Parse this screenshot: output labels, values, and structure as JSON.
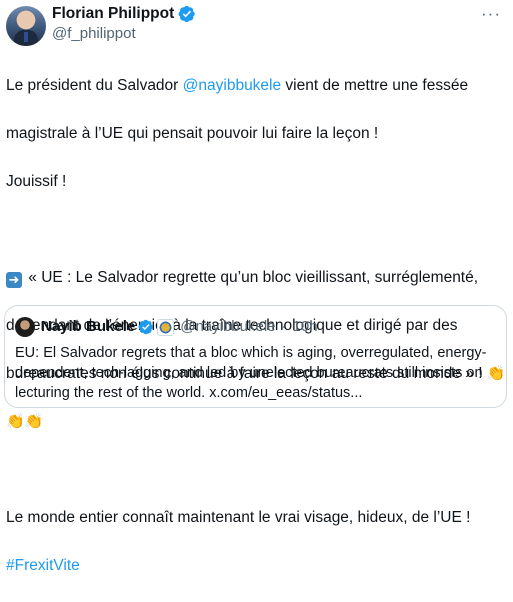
{
  "author": {
    "name": "Florian Philippot",
    "handle": "@f_philippot"
  },
  "more_label": "···",
  "tweet": {
    "p1_l1_before": "Le président du Salvador ",
    "p1_l1_mention": "@nayibbukele",
    "p1_l1_after": " vient de mettre une fessée",
    "p1_l2": "magistrale à l’UE qui pensait pouvoir lui faire la leçon !",
    "p1_l3": "Jouissif !",
    "p2_l1": " « UE : Le Salvador regrette qu’un bloc vieillissant, surréglementé,",
    "p2_l2": "dépendant de l’énergie, à la traîne technologique et dirigé par des",
    "p2_l3": "bureaucrates non élus continue à faire la leçon au reste du monde » !",
    "p3_l1": "Le monde entier connaît maintenant le vrai visage, hideux, de l’UE !",
    "hashtag": "#FrexitVite"
  },
  "quote": {
    "name": "Nayib Bukele",
    "handle": "@nayibbukele",
    "separator": "·",
    "time": "10h",
    "l1": "EU: El Salvador regrets that a bloc which is aging, overregulated, energy-",
    "l2": "dependent, tech-lagging, and led by unelected bureaucrats still insists on",
    "l3": "lecturing the rest of the world. x.com/eu_eeas/status..."
  },
  "icons": {
    "verified": "verified-badge-icon",
    "arrow": "right-arrow-emoji-icon",
    "clap": "clapping-hands-emoji-icon",
    "seal": "government-seal-icon"
  },
  "colors": {
    "link": "#1d9bf0",
    "verified": "#1d9bf0",
    "muted": "#536471",
    "border": "#cfd9de"
  }
}
